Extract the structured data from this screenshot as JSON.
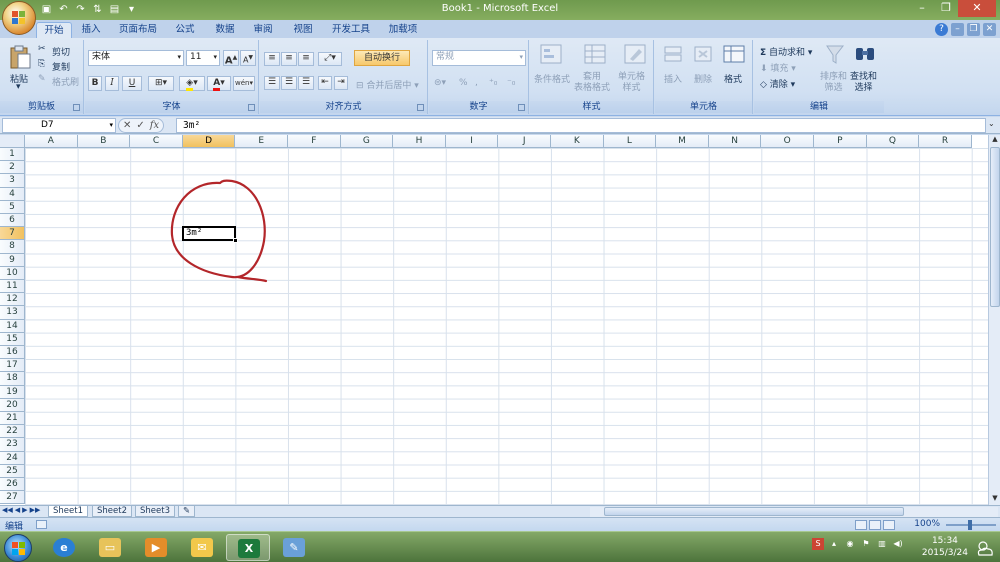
{
  "window": {
    "title": "Book1 - Microsoft Excel"
  },
  "ribbon_tabs": [
    {
      "label": "开始",
      "active": true
    },
    {
      "label": "插入"
    },
    {
      "label": "页面布局"
    },
    {
      "label": "公式"
    },
    {
      "label": "数据"
    },
    {
      "label": "审阅"
    },
    {
      "label": "视图"
    },
    {
      "label": "开发工具"
    },
    {
      "label": "加载项"
    }
  ],
  "clipboard": {
    "group_label": "剪贴板",
    "paste_label": "粘贴",
    "cut_label": "剪切",
    "copy_label": "复制",
    "format_painter_label": "格式刷"
  },
  "font": {
    "group_label": "字体",
    "font_name": "宋体",
    "font_size": "11",
    "bold": "B",
    "italic": "I",
    "underline": "U",
    "grow": "A",
    "shrink": "A",
    "font_color_glyph": "A",
    "phonetic_glyph": "wén"
  },
  "alignment": {
    "group_label": "对齐方式",
    "wrap_text_label": "自动换行",
    "merge_center_label": "合并后居中"
  },
  "number": {
    "group_label": "数字",
    "format_value": "常规",
    "percent_glyph": "%"
  },
  "styles": {
    "group_label": "样式",
    "conditional_format_label": "条件格式",
    "table_format_label": "套用\n表格格式",
    "cell_style_label": "单元格\n样式"
  },
  "cells_group": {
    "group_label": "单元格",
    "insert_label": "插入",
    "delete_label": "删除",
    "format_label": "格式"
  },
  "editing": {
    "group_label": "编辑",
    "autosum_label": "自动求和",
    "fill_label": "填充",
    "clear_label": "清除",
    "sort_filter_label": "排序和\n筛选",
    "find_select_label": "查找和\n选择"
  },
  "formula_bar": {
    "name_box": "D7",
    "cancel_glyph": "✕",
    "enter_glyph": "✓",
    "fx_glyph": "fx",
    "formula_value": "3m²"
  },
  "grid": {
    "columns": [
      "A",
      "B",
      "C",
      "D",
      "E",
      "F",
      "G",
      "H",
      "I",
      "J",
      "K",
      "L",
      "M",
      "N",
      "O",
      "P",
      "Q",
      "R"
    ],
    "rows": [
      "1",
      "2",
      "3",
      "4",
      "5",
      "6",
      "7",
      "8",
      "9",
      "10",
      "11",
      "12",
      "13",
      "14",
      "15",
      "16",
      "17",
      "18",
      "19",
      "20",
      "21",
      "22",
      "23",
      "24",
      "25",
      "26",
      "27"
    ],
    "selected_column": "D",
    "selected_row": "7",
    "active_cell_value": "3m²",
    "annotation_color": "#b3262a"
  },
  "sheets": [
    {
      "label": "Sheet1",
      "active": true
    },
    {
      "label": "Sheet2"
    },
    {
      "label": "Sheet3"
    }
  ],
  "status": {
    "mode": "编辑",
    "zoom": "100%"
  },
  "taskbar": {
    "time": "15:34",
    "date": "2015/3/24"
  },
  "icons": {
    "excel_app_color": "#1d7a3c",
    "accent": "#15428b"
  }
}
